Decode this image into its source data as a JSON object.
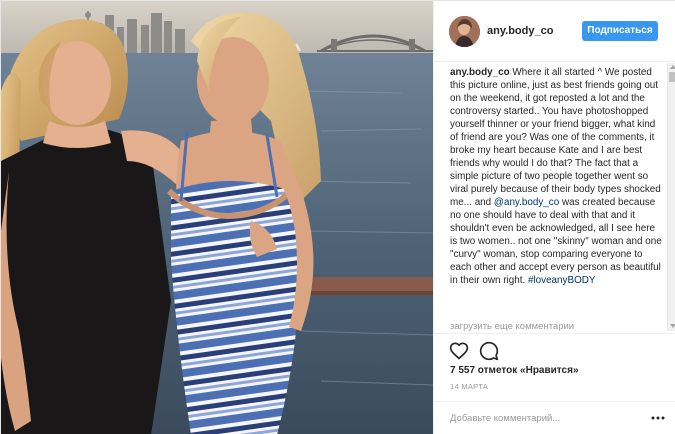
{
  "post": {
    "username": "any.body_co",
    "follow_label": "Подписаться",
    "caption": {
      "user": "any.body_co",
      "text_1": " Where it all started ^ We posted this picture online, just as best friends going out on the weekend, it got reposted a lot and the controversy started.. You have photoshopped yourself thinner or your friend bigger, what kind of friend are you? Was one of the comments, it broke my heart because Kate and I are best friends why would I do that? The fact that a simple picture of two people together went so viral purely because of their body types shocked me... and ",
      "mention": "@any.body_co",
      "text_2": " was created because no one should have to deal with that and it shouldn't even be acknowledged, all I see here is two women.. not one \"skinny\" woman and one \"curvy\" woman, stop comparing everyone to each other and accept every person as beautiful in their own right. ",
      "hashtag": "#loveanyBODY"
    },
    "load_more_label": "загрузить еще комментарии",
    "likes_text": "7 557 отметок «Нравится»",
    "date": "14 МАРТА",
    "comment_placeholder": "Добавьте комментарий...",
    "icons": {
      "like": "heart-icon",
      "comment": "comment-bubble-icon",
      "more": "more-options-icon"
    },
    "colors": {
      "follow_button": "#3897f0",
      "link": "#003569",
      "secondary_text": "#999999"
    }
  }
}
